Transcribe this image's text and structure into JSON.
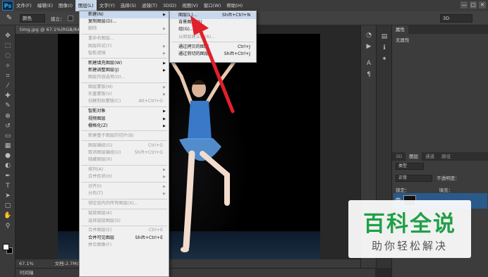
{
  "app": {
    "logo": "Ps"
  },
  "menubar": {
    "items": [
      "文件(F)",
      "编辑(E)",
      "图像(I)",
      "图层(L)",
      "文字(Y)",
      "选择(S)",
      "滤镜(T)",
      "3D(D)",
      "视图(V)",
      "窗口(W)",
      "帮助(H)"
    ],
    "active_index": 3,
    "window_controls": [
      "—",
      "□",
      "✕"
    ]
  },
  "optionsbar": {
    "tool_icon": "brush-icon",
    "mode_select": "颜色",
    "label": "建立：",
    "workspace": "3D"
  },
  "document": {
    "tab_title": "timg.jpg @ 67.1%(RGB/8#) ×",
    "zoom": "67.1%",
    "doc_info": "文档:2.7M/2.7M"
  },
  "timeline_label": "时间轴",
  "layer_menu": {
    "items": [
      {
        "label": "新建(N)",
        "arrow": true,
        "highlight": true
      },
      {
        "label": "复制图层(D)..."
      },
      {
        "label": "删除",
        "arrow": true,
        "disabled": true
      },
      {
        "sep": true
      },
      {
        "label": "重命名图层...",
        "disabled": true
      },
      {
        "label": "图层样式(Y)",
        "arrow": true,
        "disabled": true
      },
      {
        "label": "智能滤镜",
        "arrow": true,
        "disabled": true
      },
      {
        "sep": true
      },
      {
        "label": "新建填充图层(W)",
        "arrow": true
      },
      {
        "label": "新建调整图层(J)",
        "arrow": true
      },
      {
        "label": "图层内容选项(O)...",
        "disabled": true
      },
      {
        "sep": true
      },
      {
        "label": "图层蒙版(M)",
        "arrow": true,
        "disabled": true
      },
      {
        "label": "矢量蒙版(V)",
        "arrow": true,
        "disabled": true
      },
      {
        "label": "创建剪贴蒙版(C)",
        "short": "Alt+Ctrl+G",
        "disabled": true
      },
      {
        "sep": true
      },
      {
        "label": "智能对象",
        "arrow": true
      },
      {
        "label": "视频图层",
        "arrow": true
      },
      {
        "label": "栅格化(Z)",
        "arrow": true
      },
      {
        "sep": true
      },
      {
        "label": "新建基于图层的切片(B)",
        "disabled": true
      },
      {
        "sep": true
      },
      {
        "label": "图层编组(G)",
        "short": "Ctrl+G",
        "disabled": true
      },
      {
        "label": "取消图层编组(U)",
        "short": "Shift+Ctrl+G",
        "disabled": true
      },
      {
        "label": "隐藏图层(R)",
        "disabled": true
      },
      {
        "sep": true
      },
      {
        "label": "排列(A)",
        "arrow": true,
        "disabled": true
      },
      {
        "label": "合并形状(H)",
        "arrow": true,
        "disabled": true
      },
      {
        "sep": true
      },
      {
        "label": "对齐(I)",
        "arrow": true,
        "disabled": true
      },
      {
        "label": "分布(T)",
        "arrow": true,
        "disabled": true
      },
      {
        "sep": true
      },
      {
        "label": "锁定组内的所有图层(X)...",
        "disabled": true
      },
      {
        "sep": true
      },
      {
        "label": "链接图层(K)",
        "disabled": true
      },
      {
        "label": "选择链接图层(S)",
        "disabled": true
      },
      {
        "sep": true
      },
      {
        "label": "合并图层(E)",
        "short": "Ctrl+E",
        "disabled": true
      },
      {
        "label": "合并可见图层",
        "short": "Shift+Ctrl+E"
      },
      {
        "label": "拼合图像(F)",
        "disabled": true
      }
    ]
  },
  "new_submenu": {
    "items": [
      {
        "label": "图层(L)...",
        "short": "Shift+Ctrl+N",
        "highlight": true
      },
      {
        "label": "背景图层(B)"
      },
      {
        "label": "组(G)..."
      },
      {
        "label": "从图层建立组(A)...",
        "disabled": true
      },
      {
        "sep": true
      },
      {
        "label": "通过拷贝的图层",
        "short": "Ctrl+J"
      },
      {
        "label": "通过剪切的图层",
        "short": "Shift+Ctrl+J"
      }
    ]
  },
  "properties_panel": {
    "tab": "属性",
    "body": "无属性"
  },
  "layers_panel": {
    "tabs": [
      "3D",
      "图层",
      "通道",
      "路径"
    ],
    "kind_filter": "类型",
    "blend_mode": "正常",
    "opacity_label": "不透明度：",
    "lock_label": "锁定：",
    "fill_label": "填充："
  },
  "mid_dock_icons": [
    "history-icon",
    "actions-icon",
    "character-icon",
    "paragraph-icon",
    "adjust-icon"
  ],
  "toolbar_icons": [
    "move-icon",
    "marquee-icon",
    "lasso-icon",
    "quick-select-icon",
    "crop-icon",
    "eyedropper-icon",
    "healing-icon",
    "brush-icon",
    "clone-icon",
    "history-brush-icon",
    "eraser-icon",
    "gradient-icon",
    "blur-icon",
    "dodge-icon",
    "pen-icon",
    "type-icon",
    "path-select-icon",
    "shape-icon",
    "hand-icon",
    "zoom-icon"
  ],
  "watermark": {
    "title": "百科全说",
    "subtitle": "助你轻松解决"
  },
  "colors": {
    "menu_bg": "#3b3b3b",
    "panel_bg": "#3c3c3c",
    "menu_highlight": "#c8d8ee",
    "arrow_red": "#e0202a",
    "watermark_green": "#20a048"
  }
}
